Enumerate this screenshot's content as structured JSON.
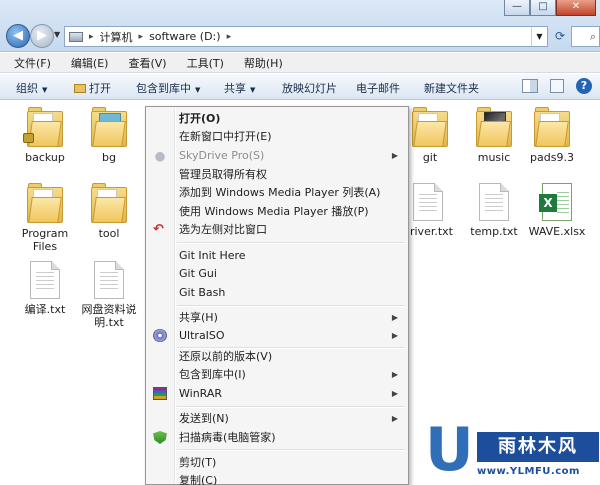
{
  "address": {
    "path": [
      "计算机",
      "software (D:)"
    ]
  },
  "window_controls": {
    "minimize": "—",
    "maximize": "□",
    "close": "✕"
  },
  "menubar": {
    "items": [
      "文件(F)",
      "编辑(E)",
      "查看(V)",
      "工具(T)",
      "帮助(H)"
    ]
  },
  "cmdbar": {
    "organize": "组织",
    "open": "打开",
    "include_in_library": "包含到库中",
    "share": "共享",
    "slideshow": "放映幻灯片",
    "email": "电子邮件",
    "new_folder": "新建文件夹"
  },
  "files": [
    {
      "name": "backup",
      "type": "folder-locked"
    },
    {
      "name": "bg",
      "type": "folder-teal"
    },
    {
      "name": "git",
      "type": "folder"
    },
    {
      "name": "music",
      "type": "folder-photo"
    },
    {
      "name": "pads9.3",
      "type": "folder"
    },
    {
      "name": "Program Files",
      "type": "folder"
    },
    {
      "name": "tool",
      "type": "folder"
    },
    {
      "name": "driver.txt",
      "type": "text-document"
    },
    {
      "name": "temp.txt",
      "type": "text-document"
    },
    {
      "name": "WAVE.xlsx",
      "type": "excel-document"
    },
    {
      "name": "编译.txt",
      "type": "text-document"
    },
    {
      "name": "网盘资料说明.txt",
      "type": "text-document"
    }
  ],
  "context_menu": {
    "items": [
      {
        "label": "打开(O)",
        "bold": true
      },
      {
        "label": "在新窗口中打开(E)"
      },
      {
        "label": "SkyDrive Pro(S)",
        "disabled": true,
        "submenu": true,
        "icon": "cloud-icon"
      },
      {
        "label": "管理员取得所有权"
      },
      {
        "label": "添加到 Windows Media Player 列表(A)"
      },
      {
        "label": "使用 Windows Media Player 播放(P)"
      },
      {
        "label": "选为左侧对比窗口",
        "icon": "undo-arrow-icon"
      },
      {
        "label": "Git Init Here"
      },
      {
        "label": "Git Gui"
      },
      {
        "label": "Git Bash"
      },
      {
        "label": "共享(H)",
        "submenu": true
      },
      {
        "label": "UltraISO",
        "submenu": true,
        "icon": "disc-icon"
      },
      {
        "label": "还原以前的版本(V)"
      },
      {
        "label": "包含到库中(I)",
        "submenu": true
      },
      {
        "label": "WinRAR",
        "submenu": true,
        "icon": "winrar-icon"
      },
      {
        "label": "发送到(N)",
        "submenu": true
      },
      {
        "label": "扫描病毒(电脑管家)",
        "icon": "shield-icon"
      },
      {
        "label": "剪切(T)"
      },
      {
        "label": "复制(C)"
      }
    ]
  },
  "watermark": {
    "letter": "U",
    "brand": "雨林木风",
    "url": "www.YLMFU.com"
  }
}
